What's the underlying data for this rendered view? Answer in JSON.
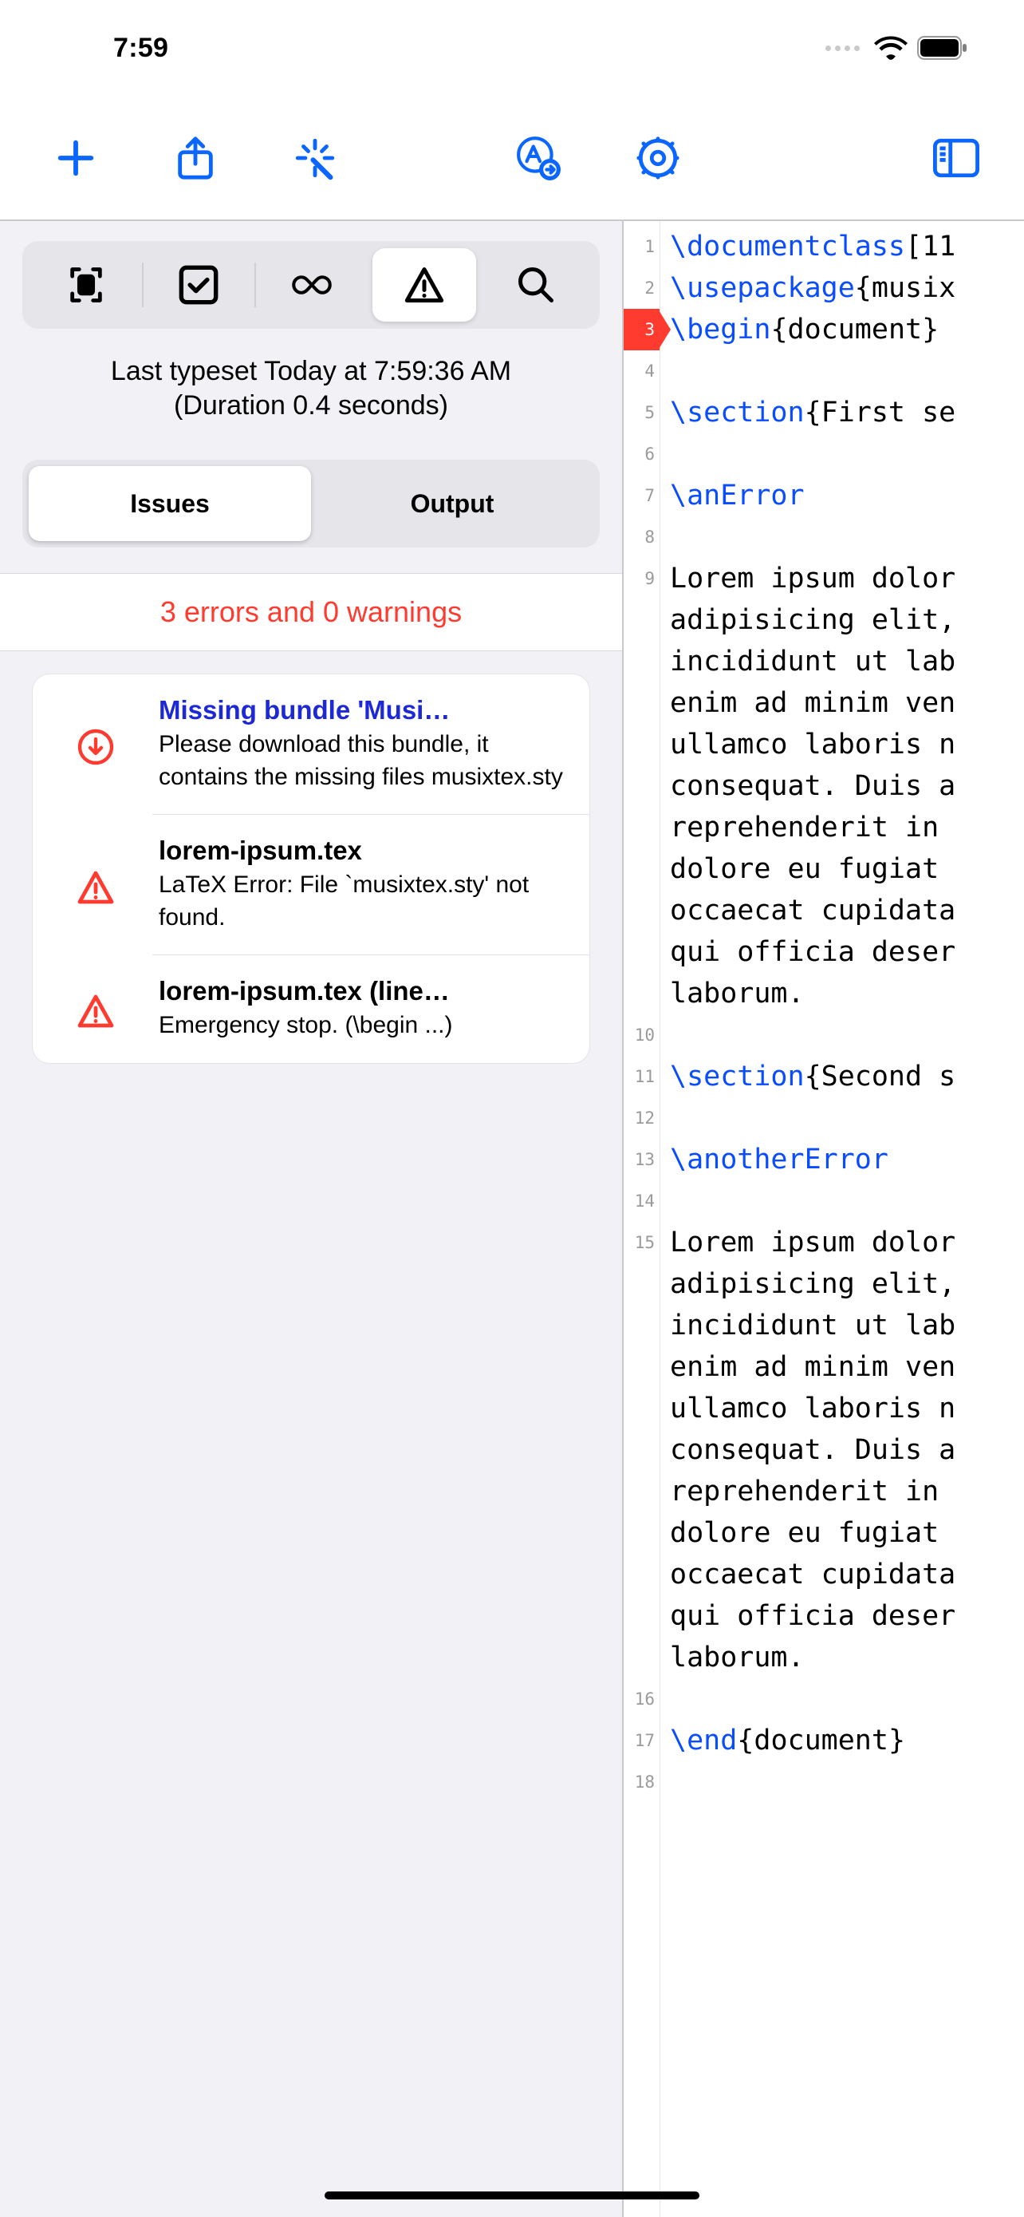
{
  "status": {
    "time": "7:59"
  },
  "left": {
    "typeset_line1": "Last typeset Today at 7:59:36 AM",
    "typeset_line2": "(Duration 0.4 seconds)",
    "seg": {
      "issues": "Issues",
      "output": "Output"
    },
    "summary": "3 errors and 0 warnings",
    "issues": [
      {
        "title": "Missing bundle 'Musi…",
        "detail": "Please download this bundle, it contains the missing files musixtex.sty",
        "kind": "download",
        "link": true
      },
      {
        "title": "lorem-ipsum.tex",
        "detail": "LaTeX Error: File `musixtex.sty' not found.",
        "kind": "error"
      },
      {
        "title": "lorem-ipsum.tex (line…",
        "detail": "Emergency stop. (\\begin ...)",
        "kind": "error"
      }
    ]
  },
  "code": {
    "lines": [
      {
        "n": 1,
        "t": "\\documentclass[11"
      },
      {
        "n": 2,
        "t": "\\usepackage{musix"
      },
      {
        "n": 3,
        "t": "\\begin{document}",
        "err": true
      },
      {
        "n": 4,
        "t": ""
      },
      {
        "n": 5,
        "t": "\\section{First se"
      },
      {
        "n": 6,
        "t": ""
      },
      {
        "n": 7,
        "t": "\\anError"
      },
      {
        "n": 8,
        "t": ""
      },
      {
        "n": 9,
        "t": "Lorem ipsum dolor\nadipisicing elit,\nincididunt ut lab\nenim ad minim ven\nullamco laboris n\nconsequat. Duis a\nreprehenderit in \ndolore eu fugiat \noccaecat cupidata\nqui officia deser\nlaborum.",
        "wrap": 11
      },
      {
        "n": 10,
        "t": ""
      },
      {
        "n": 11,
        "t": "\\section{Second s"
      },
      {
        "n": 12,
        "t": ""
      },
      {
        "n": 13,
        "t": "\\anotherError"
      },
      {
        "n": 14,
        "t": ""
      },
      {
        "n": 15,
        "t": "Lorem ipsum dolor\nadipisicing elit,\nincididunt ut lab\nenim ad minim ven\nullamco laboris n\nconsequat. Duis a\nreprehenderit in \ndolore eu fugiat \noccaecat cupidata\nqui officia deser\nlaborum.",
        "wrap": 11
      },
      {
        "n": 16,
        "t": ""
      },
      {
        "n": 17,
        "t": "\\end{document}"
      },
      {
        "n": 18,
        "t": ""
      }
    ]
  }
}
